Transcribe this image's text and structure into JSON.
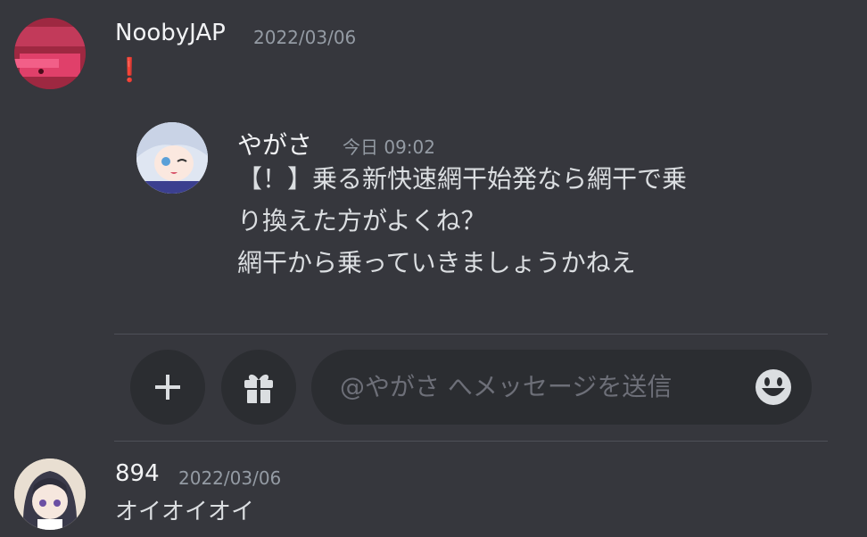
{
  "messages": [
    {
      "username": "NoobyJAP",
      "timestamp": "2022/03/06",
      "content": "❗"
    },
    {
      "username": "894",
      "timestamp": "2022/03/06",
      "content": "オイオイオイ"
    }
  ],
  "reply_preview": {
    "username": "やがさ",
    "timestamp": "今日 09:02",
    "lines": [
      "【！】乗る新快速網干始発なら網干で乗",
      "り換えた方がよくね？",
      "網干から乗っていきましょうかねえ"
    ]
  },
  "composer": {
    "placeholder": "@やがさ へメッセージを送信"
  },
  "icons": {
    "add": "plus-icon",
    "gift": "gift-icon",
    "emoji": "emoji-smile-icon"
  },
  "colors": {
    "background": "#36373d",
    "input_background": "#2b2d31",
    "exclamation": "#e02a2a"
  }
}
